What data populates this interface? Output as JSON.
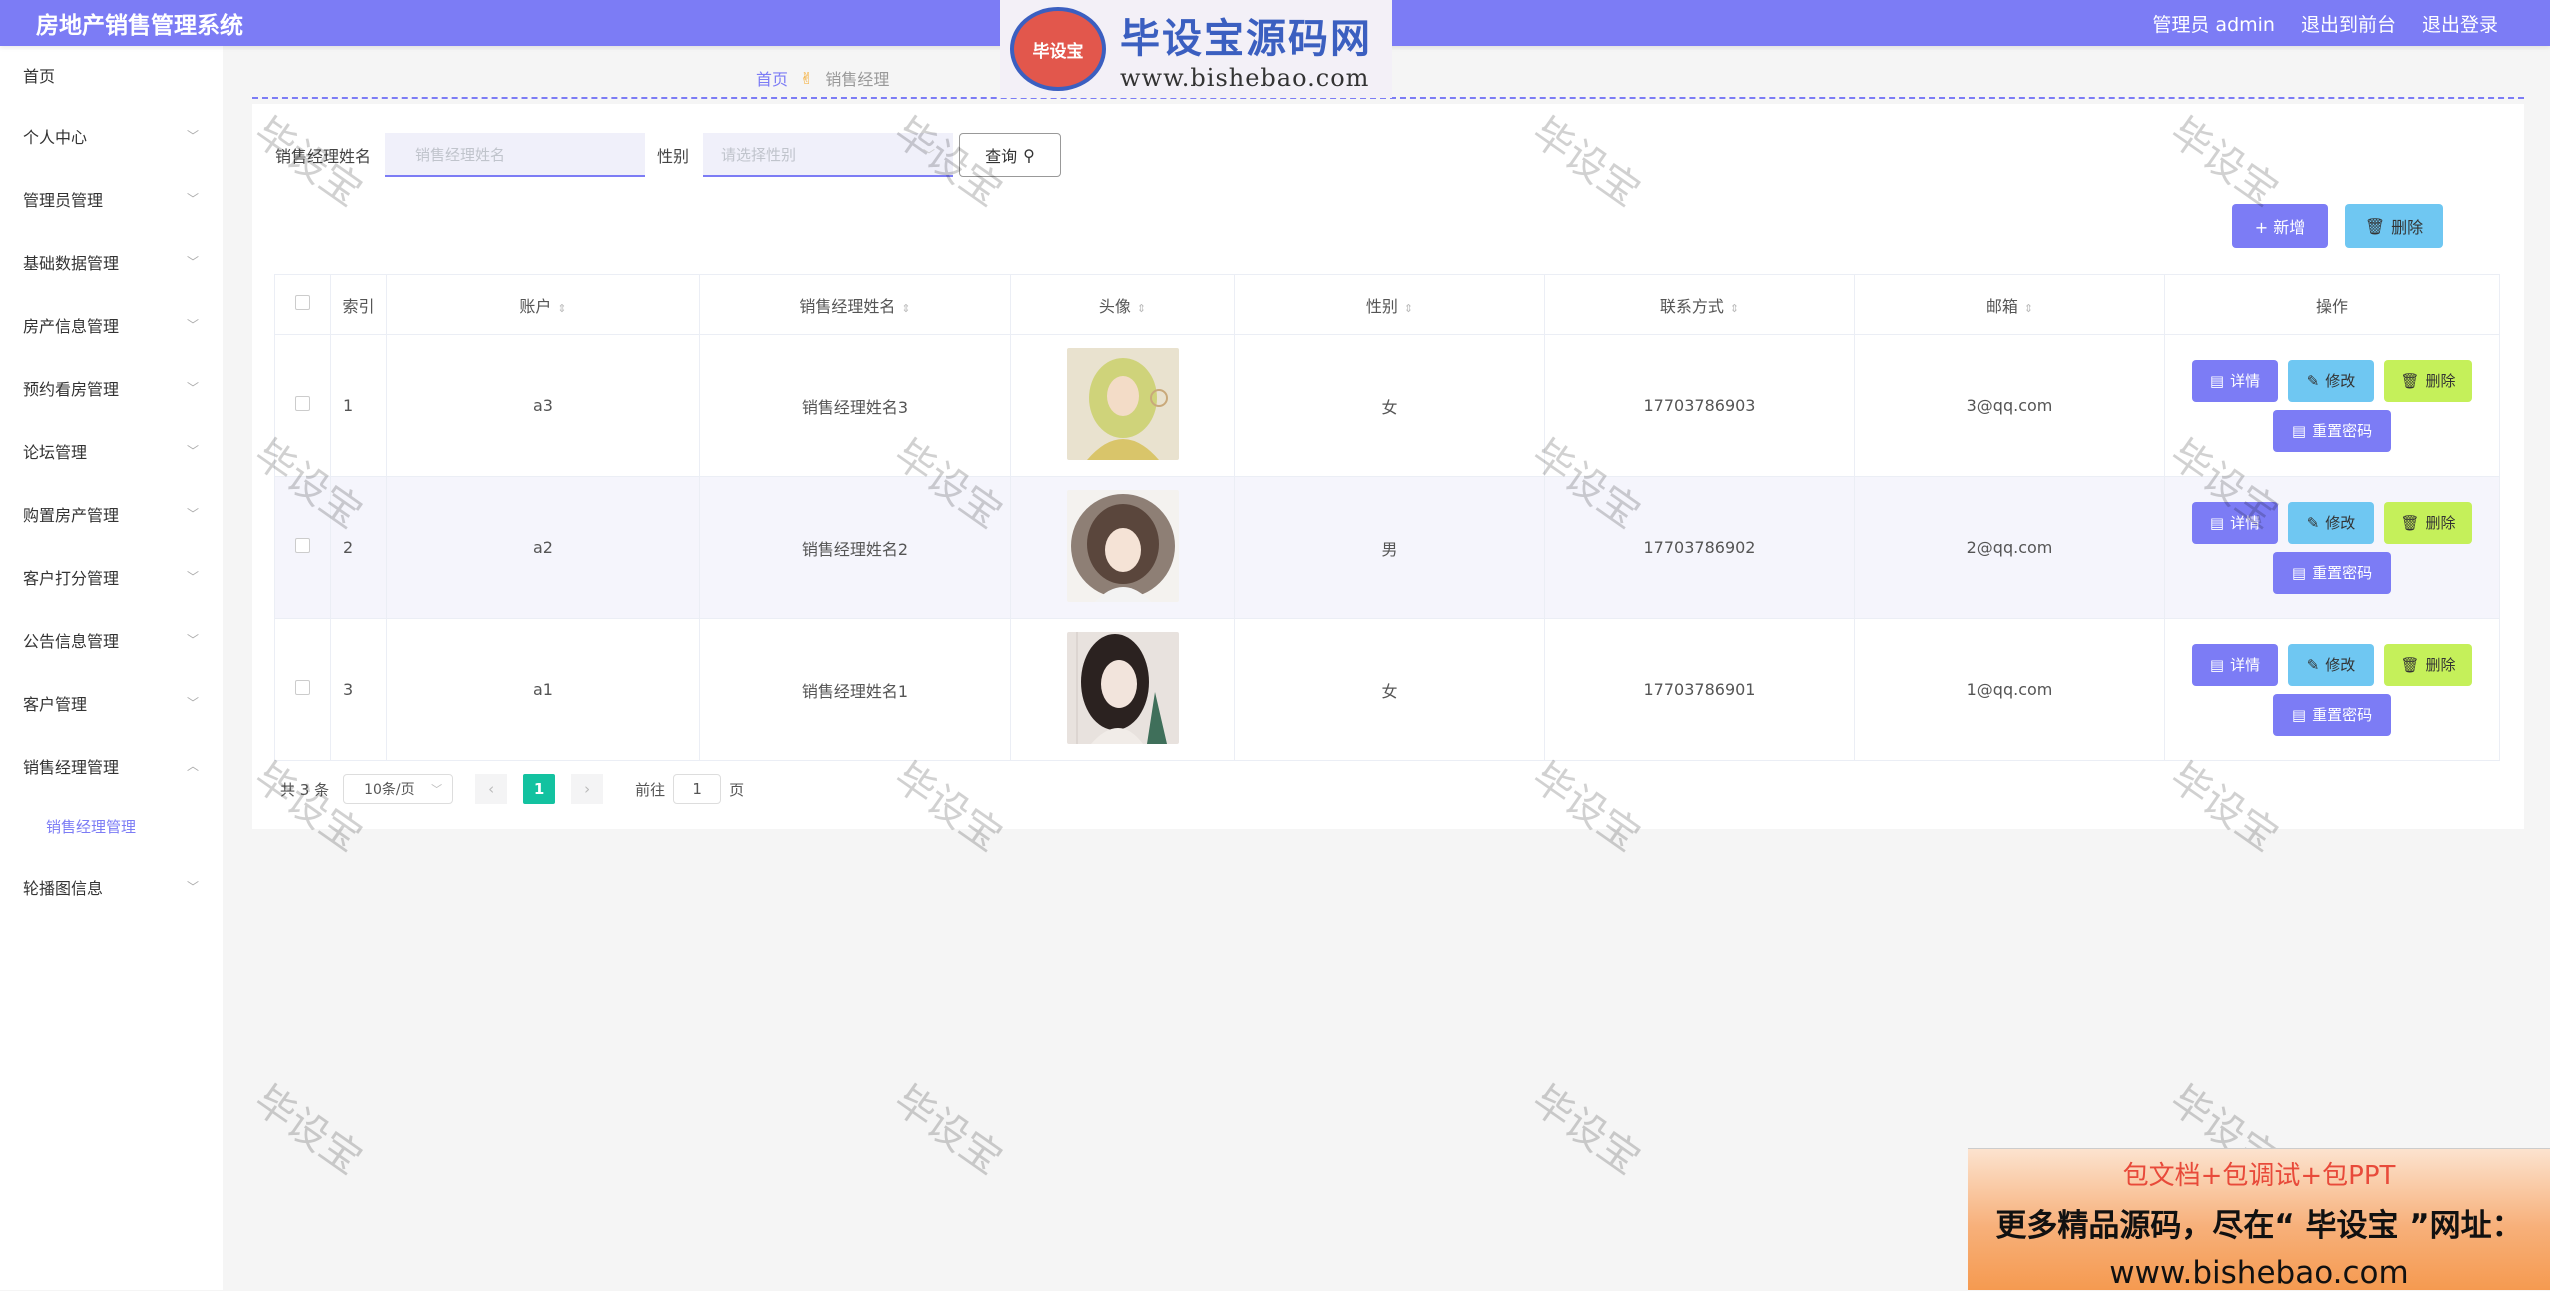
{
  "app": {
    "title": "房地产销售管理系统",
    "user_label": "管理员 admin",
    "to_front": "退出到前台",
    "logout": "退出登录"
  },
  "sidebar": {
    "items": [
      {
        "label": "首页",
        "chevron": false
      },
      {
        "label": "个人中心",
        "chevron": true
      },
      {
        "label": "管理员管理",
        "chevron": true
      },
      {
        "label": "基础数据管理",
        "chevron": true
      },
      {
        "label": "房产信息管理",
        "chevron": true
      },
      {
        "label": "预约看房管理",
        "chevron": true
      },
      {
        "label": "论坛管理",
        "chevron": true
      },
      {
        "label": "购置房产管理",
        "chevron": true
      },
      {
        "label": "客户打分管理",
        "chevron": true
      },
      {
        "label": "公告信息管理",
        "chevron": true
      },
      {
        "label": "客户管理",
        "chevron": true
      },
      {
        "label": "销售经理管理",
        "chevron": true,
        "expanded": true
      }
    ],
    "sub_item": "销售经理管理",
    "last_item": "轮播图信息"
  },
  "breadcrumb": {
    "home": "首页",
    "current": "销售经理"
  },
  "search": {
    "name_label": "销售经理姓名",
    "name_placeholder": "销售经理姓名",
    "gender_label": "性别",
    "gender_placeholder": "请选择性别",
    "query_label": "查询"
  },
  "actions": {
    "add_label": "+ 新增",
    "delete_label": "删除"
  },
  "table": {
    "columns": [
      "索引",
      "账户",
      "销售经理姓名",
      "头像",
      "性别",
      "联系方式",
      "邮箱",
      "操作"
    ],
    "rows": [
      {
        "index": "1",
        "account": "a3",
        "name": "销售经理姓名3",
        "avatar": "avatar-1",
        "gender": "女",
        "phone": "17703786903",
        "email": "3@qq.com"
      },
      {
        "index": "2",
        "account": "a2",
        "name": "销售经理姓名2",
        "avatar": "avatar-2",
        "gender": "男",
        "phone": "17703786902",
        "email": "2@qq.com"
      },
      {
        "index": "3",
        "account": "a1",
        "name": "销售经理姓名1",
        "avatar": "avatar-3",
        "gender": "女",
        "phone": "17703786901",
        "email": "1@qq.com"
      }
    ],
    "op_labels": {
      "detail": "详情",
      "edit": "修改",
      "delete": "删除",
      "reset": "重置密码"
    }
  },
  "pagination": {
    "total": "共 3 条",
    "page_size": "10条/页",
    "current_page": "1",
    "goto_label": "前往",
    "goto_value": "1",
    "page_suffix": "页"
  },
  "watermark": {
    "text": "毕设宝",
    "logo_badge": "毕设宝",
    "logo_name": "毕设宝源码网",
    "logo_url": "www.bishebao.com"
  },
  "ad": {
    "line1": "包文档+包调试+包PPT",
    "line2": "更多精品源码，尽在“ 毕设宝 ”网址：",
    "line3": "www.bishebao.com"
  },
  "colors": {
    "primary": "#7c7cf5",
    "info": "#6fc7f2",
    "success": "#c5f05a",
    "page_active": "#13c2a0"
  }
}
